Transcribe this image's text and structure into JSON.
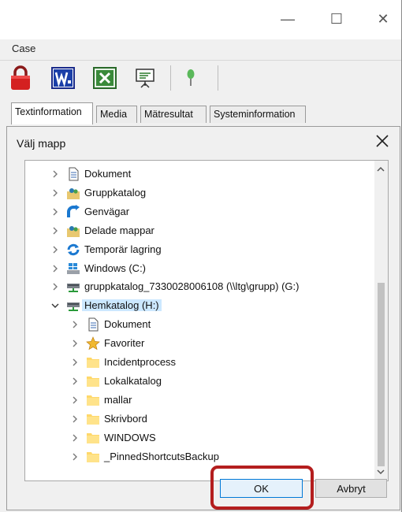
{
  "window": {
    "app_title": "Case",
    "controls": {
      "minimize": "—",
      "maximize": "☐",
      "close": "✕"
    }
  },
  "toolbar": {
    "items": [
      "lock-icon",
      "word-icon",
      "excel-icon",
      "presentation-icon",
      "pin-icon"
    ]
  },
  "tabs": [
    {
      "label": "Textinformation",
      "active": true
    },
    {
      "label": "Media",
      "active": false
    },
    {
      "label": "Mätresultat",
      "active": false
    },
    {
      "label": "Systeminformation",
      "active": false
    }
  ],
  "dialog": {
    "title": "Välj mapp",
    "ok_label": "OK",
    "cancel_label": "Avbryt",
    "tree": [
      {
        "label": "Dokument",
        "icon": "document-icon",
        "level": 1,
        "expanded": false
      },
      {
        "label": "Gruppkatalog",
        "icon": "group-folder-icon",
        "level": 1,
        "expanded": false
      },
      {
        "label": "Genvägar",
        "icon": "shortcut-icon",
        "level": 1,
        "expanded": false
      },
      {
        "label": "Delade mappar",
        "icon": "shared-folder-icon",
        "level": 1,
        "expanded": false
      },
      {
        "label": "Temporär lagring",
        "icon": "sync-icon",
        "level": 1,
        "expanded": false
      },
      {
        "label": "Windows (C:)",
        "icon": "windows-drive-icon",
        "level": 1,
        "expanded": false
      },
      {
        "label": "gruppkatalog_7330028006108 (\\\\ltg\\grupp) (G:)",
        "icon": "network-drive-icon",
        "level": 1,
        "expanded": false
      },
      {
        "label": "Hemkatalog (H:)",
        "icon": "network-drive-icon",
        "level": 1,
        "expanded": true,
        "selected": true
      },
      {
        "label": "Dokument",
        "icon": "document-icon",
        "level": 2,
        "expanded": false
      },
      {
        "label": "Favoriter",
        "icon": "star-icon",
        "level": 2,
        "expanded": false
      },
      {
        "label": "Incidentprocess",
        "icon": "folder-icon",
        "level": 2,
        "expanded": false
      },
      {
        "label": "Lokalkatalog",
        "icon": "folder-icon",
        "level": 2,
        "expanded": false
      },
      {
        "label": "mallar",
        "icon": "folder-icon",
        "level": 2,
        "expanded": false
      },
      {
        "label": "Skrivbord",
        "icon": "folder-icon",
        "level": 2,
        "expanded": false
      },
      {
        "label": "WINDOWS",
        "icon": "folder-icon",
        "level": 2,
        "expanded": false
      },
      {
        "label": "_PinnedShortcutsBackup",
        "icon": "folder-icon",
        "level": 2,
        "expanded": false
      }
    ]
  },
  "colors": {
    "selection": "#cce8ff",
    "highlight_box": "#b41e1e",
    "ok_border": "#0078d7"
  }
}
